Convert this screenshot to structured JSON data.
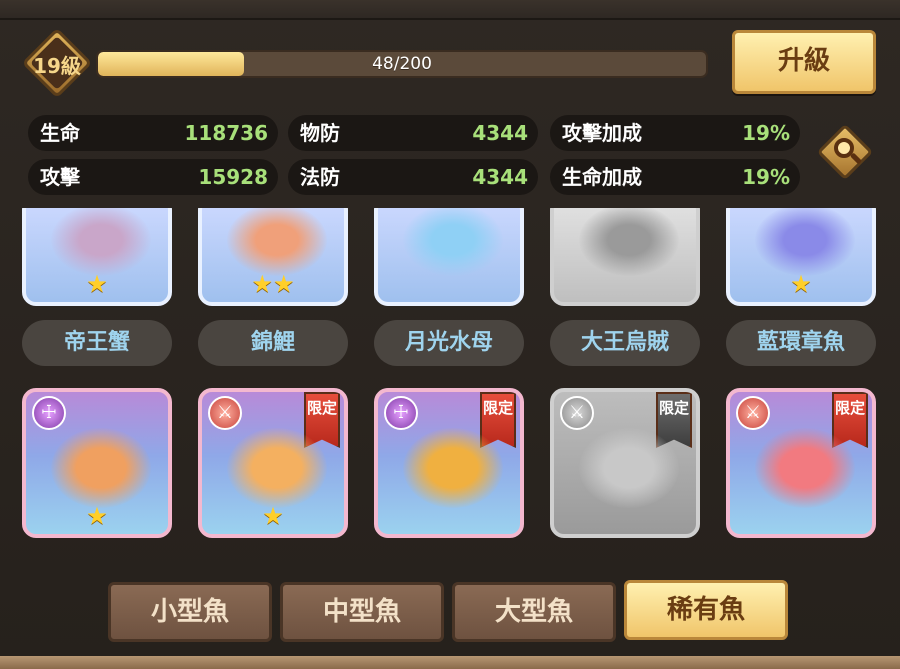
{
  "level": {
    "label": "19級",
    "xp_text": "48/200",
    "xp_fraction": 0.24
  },
  "upgrade_button": {
    "label": "升級"
  },
  "stats": [
    {
      "label": "生命",
      "value": "118736"
    },
    {
      "label": "物防",
      "value": "4344"
    },
    {
      "label": "攻擊加成",
      "value": "19%"
    },
    {
      "label": "攻擊",
      "value": "15928"
    },
    {
      "label": "法防",
      "value": "4344"
    },
    {
      "label": "生命加成",
      "value": "19%"
    }
  ],
  "top_row": [
    {
      "name": "帝王蟹",
      "stars": "★",
      "gray": false,
      "color": "#c9a6c9"
    },
    {
      "name": "錦鯉",
      "stars": "★★",
      "gray": false,
      "color": "#f0a07a"
    },
    {
      "name": "月光水母",
      "stars": "",
      "gray": false,
      "color": "#8fd0f5"
    },
    {
      "name": "大王烏賊",
      "stars": "",
      "gray": true,
      "color": "#9a9a9a"
    },
    {
      "name": "藍環章魚",
      "stars": "★",
      "gray": false,
      "color": "#8a8ae8"
    }
  ],
  "bottom_row": [
    {
      "faction": "☩",
      "limited": "",
      "stars": "★",
      "gray": false,
      "color": "#f0a060",
      "faction_class": ""
    },
    {
      "faction": "⚔",
      "limited": "限定",
      "stars": "★",
      "gray": false,
      "color": "#f4b060",
      "faction_class": "red"
    },
    {
      "faction": "☩",
      "limited": "限定",
      "stars": "",
      "gray": false,
      "color": "#f0b040",
      "faction_class": ""
    },
    {
      "faction": "⚔",
      "limited": "限定",
      "stars": "",
      "gray": true,
      "color": "#c8c8c8",
      "faction_class": "gray"
    },
    {
      "faction": "⚔",
      "limited": "限定",
      "stars": "",
      "gray": false,
      "color": "#f27a80",
      "faction_class": "red"
    }
  ],
  "tabs": [
    {
      "label": "小型魚",
      "active": false
    },
    {
      "label": "中型魚",
      "active": false
    },
    {
      "label": "大型魚",
      "active": false
    },
    {
      "label": "稀有魚",
      "active": true
    }
  ]
}
